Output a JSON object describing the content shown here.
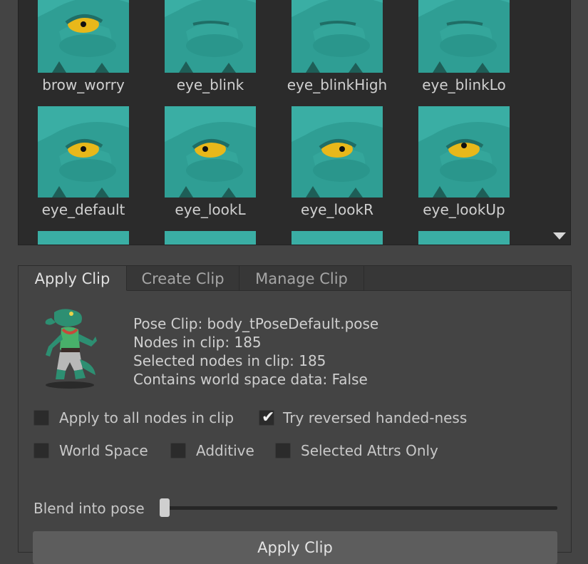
{
  "gallery": {
    "items": [
      {
        "label": "brow_worry",
        "pupil": "visible"
      },
      {
        "label": "eye_blink",
        "pupil": "closed"
      },
      {
        "label": "eye_blinkHigh",
        "pupil": "closed"
      },
      {
        "label": "eye_blinkLo",
        "pupil": "closed"
      },
      {
        "label": "eye_default",
        "pupil": "center"
      },
      {
        "label": "eye_lookL",
        "pupil": "left"
      },
      {
        "label": "eye_lookR",
        "pupil": "right"
      },
      {
        "label": "eye_lookUp",
        "pupil": "up"
      }
    ],
    "scroll_icon": "triangle-down-icon"
  },
  "tabs": [
    {
      "label": "Apply Clip",
      "active": true
    },
    {
      "label": "Create Clip",
      "active": false
    },
    {
      "label": "Manage Clip",
      "active": false
    }
  ],
  "clip_info": {
    "pose_clip": "Pose Clip: body_tPoseDefault.pose",
    "nodes": "Nodes in clip: 185",
    "selected_nodes": "Selected nodes in clip: 185",
    "world_space": "Contains world space data: False"
  },
  "options": {
    "apply_all": {
      "label": "Apply to all nodes in clip",
      "checked": false
    },
    "reversed": {
      "label": "Try reversed handed-ness",
      "checked": true
    },
    "world_space": {
      "label": "World Space",
      "checked": false
    },
    "additive": {
      "label": "Additive",
      "checked": false
    },
    "selected_attrs": {
      "label": "Selected Attrs Only",
      "checked": false
    }
  },
  "blend": {
    "label": "Blend into pose",
    "value": 0
  },
  "apply_button": {
    "label": "Apply Clip"
  },
  "colors": {
    "skin": "#2f9e94",
    "eye": "#e8b81a",
    "background": "#444444"
  }
}
